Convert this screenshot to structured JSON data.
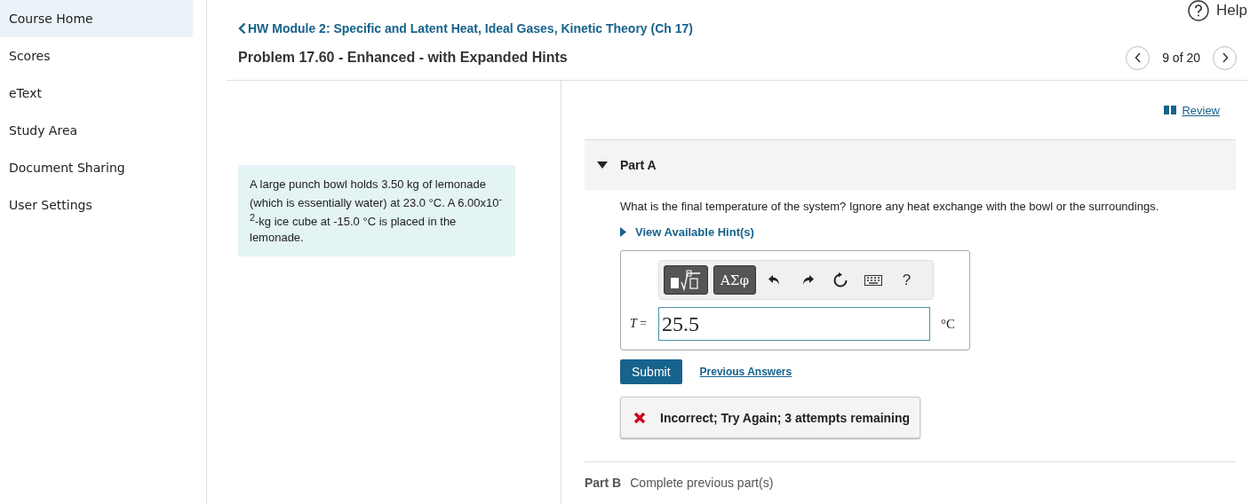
{
  "sidebar": {
    "items": [
      {
        "label": "Course Home",
        "selected": true
      },
      {
        "label": "Scores",
        "selected": false
      },
      {
        "label": "eText",
        "selected": false
      },
      {
        "label": "Study Area",
        "selected": false
      },
      {
        "label": "Document Sharing",
        "selected": false
      },
      {
        "label": "User Settings",
        "selected": false
      }
    ]
  },
  "header": {
    "help": "Help",
    "breadcrumb": "HW Module 2: Specific and Latent Heat, Ideal Gases, Kinetic Theory (Ch 17)",
    "problem_title": "Problem 17.60 - Enhanced - with Expanded Hints",
    "pager": "9 of 20"
  },
  "problem_text": "A large punch bowl holds 3.50 kg of lemonade (which is essentially water) at 23.0 °C. A 6.00x10$^{-2}$-kg ice cube at -15.0 °C is placed in the lemonade.",
  "review_link": "Review",
  "part_a": {
    "label": "Part A",
    "expanded": true,
    "question": "What is the final temperature of the system? Ignore any heat exchange with the bowl or the surroundings.",
    "hints_link": "View Available Hint(s)",
    "toolbar": [
      {
        "kind": "templates"
      },
      {
        "kind": "symbols",
        "label": "ΑΣφ"
      },
      {
        "kind": "undo"
      },
      {
        "kind": "redo"
      },
      {
        "kind": "reset"
      },
      {
        "kind": "keyboard"
      },
      {
        "kind": "help",
        "label": "?"
      }
    ],
    "variable": "T",
    "equals": "=",
    "value": "25.5",
    "unit": "°C",
    "submit": "Submit",
    "previous_answers": "Previous Answers",
    "feedback": "Incorrect; Try Again; 3 attempts remaining"
  },
  "part_b": {
    "label": "Part B",
    "status": "Complete previous part(s)"
  }
}
